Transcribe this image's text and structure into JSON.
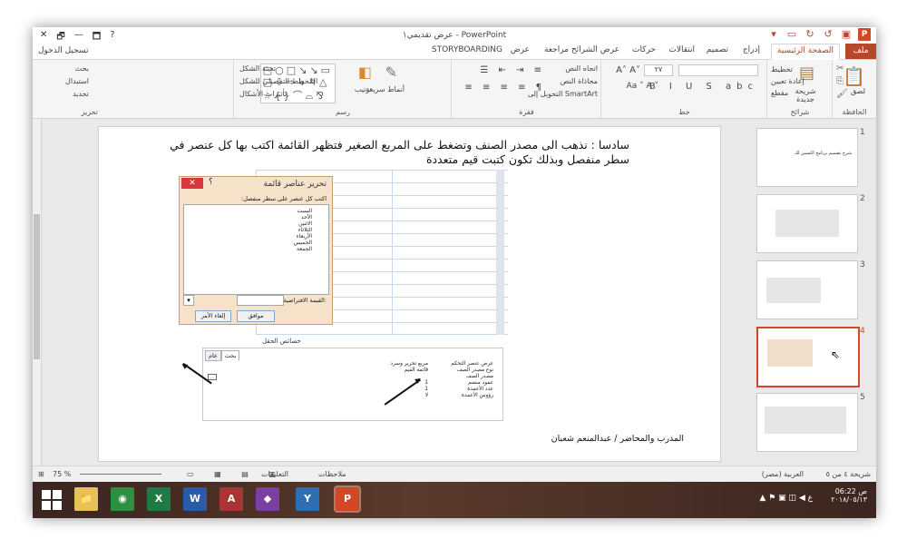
{
  "window": {
    "title": "عرض تقديمي١ - PowerPoint",
    "controls": [
      "✕",
      "🗗",
      "—",
      "🗖",
      "?"
    ]
  },
  "tabs": {
    "file": "ملف",
    "home": "الصفحة الرئيسية",
    "insert": "إدراج",
    "design": "تصميم",
    "transitions": "انتقالات",
    "animations": "حركات",
    "slideshow": "عرض الشرائح",
    "review": "مراجعة",
    "view": "عرض",
    "storyboard": "STORYBOARDING",
    "signin": "تسجيل الدخول"
  },
  "ribbon": {
    "clipboard_label": "الحافظة",
    "paste": "لصق",
    "slides_label": "شرائح",
    "new_slide": "شريحة جديدة",
    "layout": "تخطيط",
    "reset": "إعادة تعيين",
    "section": "مقطع",
    "font_label": "خط",
    "font_size": "٢٧",
    "paragraph_label": "فقرة",
    "text_direction": "اتجاه النص",
    "align_text": "محاذاة النص",
    "smartart": "التحويل إلى SmartArt",
    "drawing_label": "رسم",
    "arrange": "ترتيب",
    "quick_styles": "أنماط سريعة",
    "shape_fill": "تعبئة الشكل",
    "shape_outline": "المخطط التفصيلي للشكل",
    "shape_effects": "تأثيرات الأشكال",
    "editing_label": "تحرير",
    "find": "بحث",
    "replace": "استبدال",
    "select": "تحديد"
  },
  "slide": {
    "instruction": "سادسا : نذهب الى مصدر الصنف وتضغط على المربع الصغير فتظهر القائمة اكتب بها كل عنصر في سطر منفصل وبذلك تكون كتبت قيم متعددة",
    "footer": "المدرب والمحاضر / عبدالمنعم شعبان",
    "dialog": {
      "title": "تحرير عناصر قائمة",
      "help": "؟",
      "close": "✕",
      "prompt": "اكتب كل عنصر على سطر منفصل:",
      "items": [
        "السبت",
        "الأحد",
        "الاثنين",
        "الثلاثاء",
        "الأربعاء",
        "الخميس",
        "الجمعة"
      ],
      "default_label": "القيمة الافتراضية:",
      "ok": "موافق",
      "cancel": "إلغاء الأمر"
    },
    "field_properties_caption": "خصائص الحقل",
    "property_tabs": [
      "عام",
      "بحث"
    ],
    "properties": [
      {
        "name": "عرض عنصر التحكم",
        "value": "مربع تحرير وسرد"
      },
      {
        "name": "نوع مصدر الصف",
        "value": "قائمة القيم"
      },
      {
        "name": "مصدر الصف",
        "value": ""
      },
      {
        "name": "عمود منضم",
        "value": "1"
      },
      {
        "name": "عدد الأعمدة",
        "value": "1"
      },
      {
        "name": "رؤوس الأعمدة",
        "value": "لا"
      }
    ],
    "row_source_button": "..."
  },
  "thumbnails": [
    {
      "num": "1",
      "text": "شرح تصميم برنامج اكسس لك"
    },
    {
      "num": "2",
      "text": ""
    },
    {
      "num": "3",
      "text": ""
    },
    {
      "num": "4",
      "text": ""
    },
    {
      "num": "5",
      "text": ""
    }
  ],
  "status": {
    "slide_counter": "شريحة ٤ من ٥",
    "language": "العربية (مصر)",
    "notes": "ملاحظات",
    "comments": "التعليقات",
    "zoom": "75 %"
  },
  "taskbar": {
    "time": "06:22 ص",
    "date": "٢٠١٨/٠٥/١٣",
    "apps": [
      {
        "label": "📁",
        "color": "#e8c15a"
      },
      {
        "label": "◉",
        "color": "#2d8f3f"
      },
      {
        "label": "X",
        "color": "#1f7a45"
      },
      {
        "label": "W",
        "color": "#2b5aa6"
      },
      {
        "label": "A",
        "color": "#a83434"
      },
      {
        "label": "◆",
        "color": "#7b3f9f"
      },
      {
        "label": "Y",
        "color": "#2d6fb0"
      },
      {
        "label": "P",
        "color": "#d24726"
      }
    ],
    "tray_icons": "▲ ⚑ ▣ ◫ ◀ ع"
  },
  "colors": {
    "accent": "#b7472a",
    "selection": "#d24726"
  }
}
